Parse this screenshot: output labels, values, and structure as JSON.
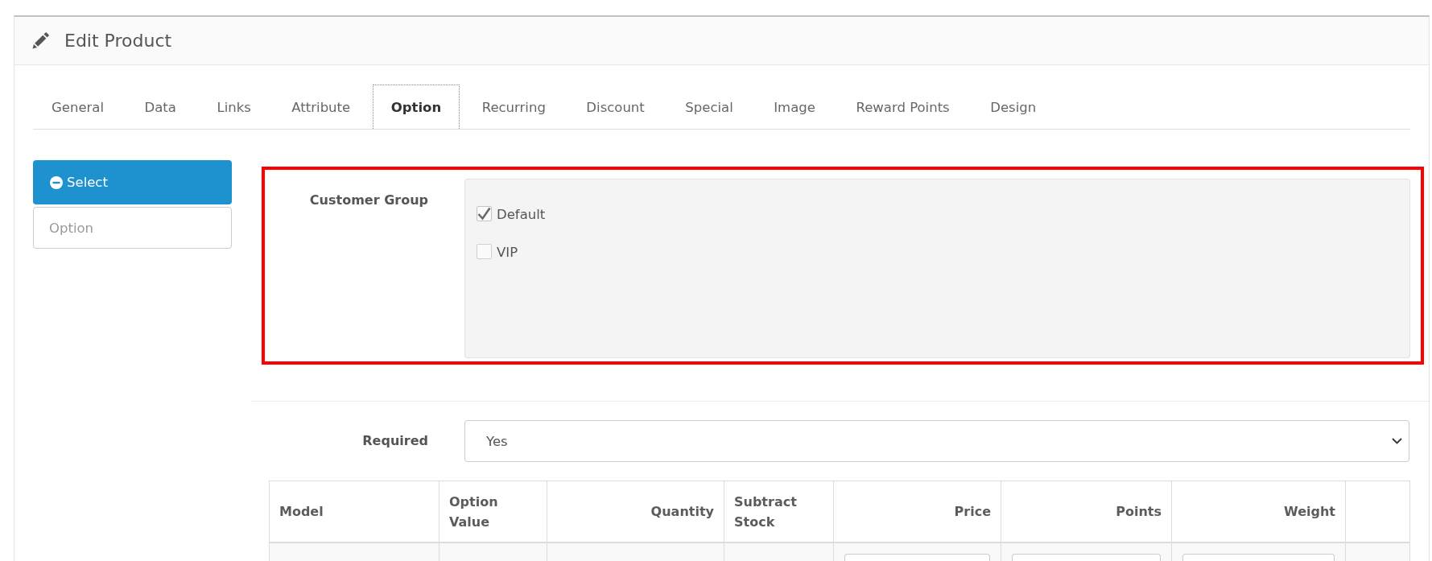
{
  "panel": {
    "title": "Edit Product"
  },
  "tabs": [
    {
      "label": "General",
      "selected": false
    },
    {
      "label": "Data",
      "selected": false
    },
    {
      "label": "Links",
      "selected": false
    },
    {
      "label": "Attribute",
      "selected": false
    },
    {
      "label": "Option",
      "selected": true
    },
    {
      "label": "Recurring",
      "selected": false
    },
    {
      "label": "Discount",
      "selected": false
    },
    {
      "label": "Special",
      "selected": false
    },
    {
      "label": "Image",
      "selected": false
    },
    {
      "label": "Reward Points",
      "selected": false
    },
    {
      "label": "Design",
      "selected": false
    }
  ],
  "option_list": {
    "items": [
      {
        "label": "Select",
        "selected": true
      }
    ],
    "search": {
      "placeholder": "Option"
    }
  },
  "customer_group": {
    "label": "Customer Group",
    "highlighted": true,
    "options": [
      {
        "label": "Default",
        "checked": true
      },
      {
        "label": "VIP",
        "checked": false
      }
    ]
  },
  "required": {
    "label": "Required",
    "value": "Yes"
  },
  "table": {
    "columns": [
      {
        "label": "Model",
        "kind": "text"
      },
      {
        "label": "Option Value",
        "kind": "text"
      },
      {
        "label": "Quantity",
        "kind": "number"
      },
      {
        "label": "Subtract Stock",
        "kind": "text"
      },
      {
        "label": "Price",
        "kind": "number"
      },
      {
        "label": "Points",
        "kind": "number"
      },
      {
        "label": "Weight",
        "kind": "number"
      },
      {
        "kind": "blank"
      }
    ],
    "rows": [
      {
        "cells": [
          {
            "kind": "blank"
          },
          {
            "kind": "blank"
          },
          {
            "kind": "blank"
          },
          {
            "kind": "blank"
          },
          {
            "kind": "input"
          },
          {
            "kind": "input"
          },
          {
            "kind": "input"
          },
          {
            "kind": "blank"
          }
        ]
      }
    ]
  }
}
